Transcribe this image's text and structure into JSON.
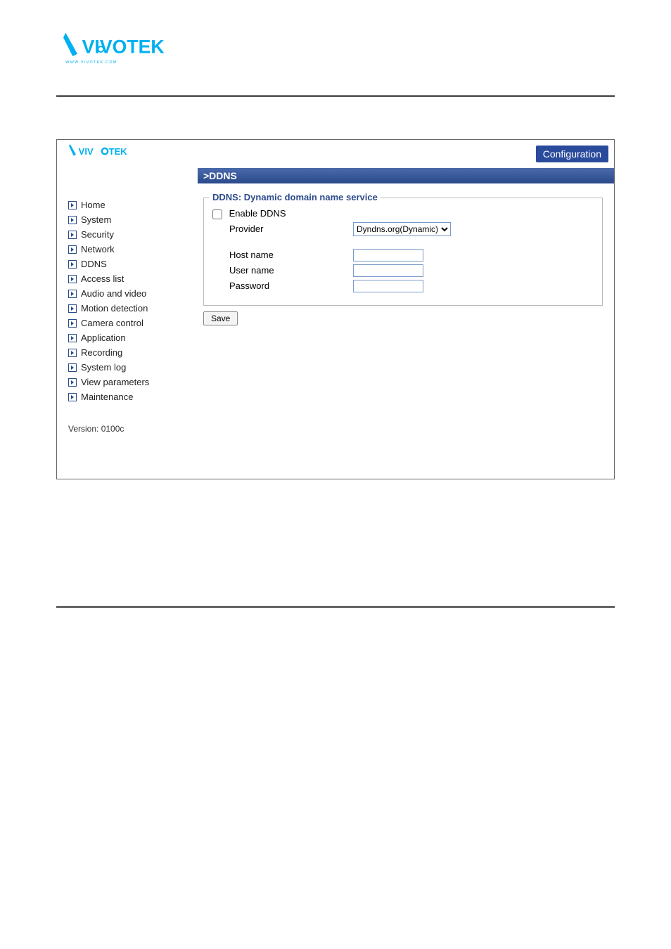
{
  "header": {
    "config_label": "Configuration",
    "title_bar": ">DDNS"
  },
  "sidebar": {
    "items": [
      {
        "label": "Home"
      },
      {
        "label": "System"
      },
      {
        "label": "Security"
      },
      {
        "label": "Network"
      },
      {
        "label": "DDNS"
      },
      {
        "label": "Access list"
      },
      {
        "label": "Audio and video"
      },
      {
        "label": "Motion detection"
      },
      {
        "label": "Camera control"
      },
      {
        "label": "Application"
      },
      {
        "label": "Recording"
      },
      {
        "label": "System log"
      },
      {
        "label": "View parameters"
      },
      {
        "label": "Maintenance"
      }
    ],
    "version": "Version: 0100c"
  },
  "content": {
    "fieldset_legend": "DDNS: Dynamic domain name service",
    "enable_label": "Enable DDNS",
    "provider_label": "Provider",
    "provider_value": "Dyndns.org(Dynamic)",
    "hostname_label": "Host name",
    "username_label": "User name",
    "password_label": "Password",
    "save_label": "Save"
  }
}
